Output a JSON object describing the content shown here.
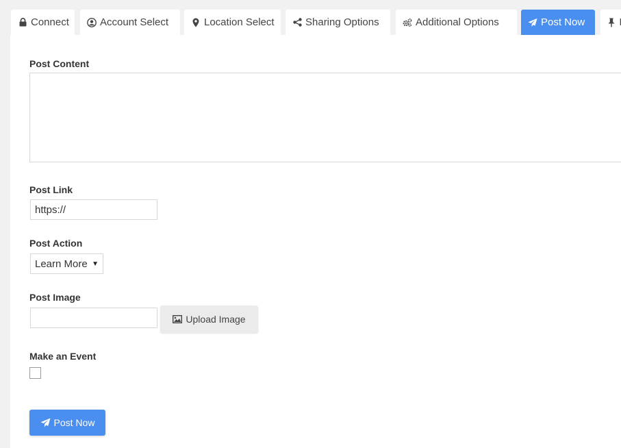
{
  "tabs": [
    {
      "label": "Connect",
      "icon": "lock-icon"
    },
    {
      "label": "Account Select",
      "icon": "user-circle-icon"
    },
    {
      "label": "Location Select",
      "icon": "map-marker-icon"
    },
    {
      "label": "Sharing Options",
      "icon": "share-icon"
    },
    {
      "label": "Additional Options",
      "icon": "gears-icon"
    },
    {
      "label": "Post Now",
      "icon": "paper-plane-icon",
      "active": true
    },
    {
      "label": "M",
      "icon": "pin-icon"
    }
  ],
  "form": {
    "content_label": "Post Content",
    "content_value": "",
    "link_label": "Post Link",
    "link_value": "https://",
    "action_label": "Post Action",
    "action_value": "Learn More",
    "image_label": "Post Image",
    "image_value": "",
    "upload_label": "Upload Image",
    "event_label": "Make an Event",
    "event_checked": false,
    "submit_label": "Post Now"
  },
  "colors": {
    "accent": "#4a8ef0",
    "background": "#f1f1f1",
    "panel": "#ffffff"
  }
}
